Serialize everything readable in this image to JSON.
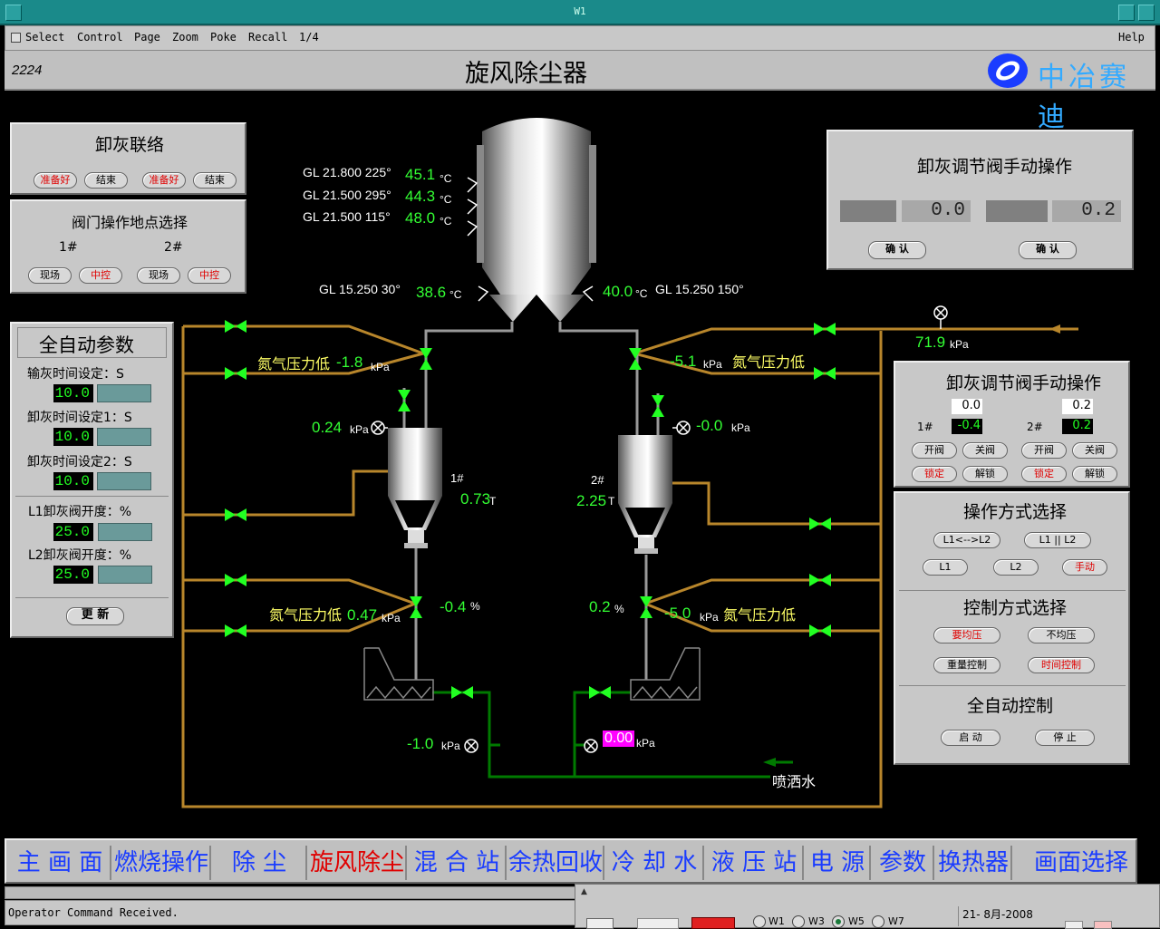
{
  "window": {
    "title": "W1"
  },
  "menu": {
    "select": "Select",
    "control": "Control",
    "page": "Page",
    "zoom": "Zoom",
    "poke": "Poke",
    "recall": "Recall",
    "page_count": "1/4",
    "help": "Help"
  },
  "header": {
    "page_id": "2224",
    "title": "旋风除尘器",
    "logo_text": "中冶赛迪"
  },
  "unload_link": {
    "title": "卸灰联络",
    "btn1": "准备好",
    "btn2": "结束",
    "btn3": "准备好",
    "btn4": "结束"
  },
  "valve_location": {
    "title": "阀门操作地点选择",
    "label1": "1#",
    "label2": "2#",
    "b1": "现场",
    "b2": "中控",
    "b3": "现场",
    "b4": "中控"
  },
  "auto_params": {
    "title": "全自动参数",
    "l1": "输灰时间设定：S",
    "v1": "10.0",
    "l2": "卸灰时间设定1：S",
    "v2": "10.0",
    "l3": "卸灰时间设定2：S",
    "v3": "10.0",
    "l4": "L1卸灰阀开度：%",
    "v4": "25.0",
    "l5": "L2卸灰阀开度：%",
    "v5": "25.0",
    "update": "更 新"
  },
  "manual_top": {
    "title": "卸灰调节阀手动操作",
    "v1": "0.0",
    "v2": "0.2",
    "confirm1": "确 认",
    "confirm2": "确 认"
  },
  "manual_right": {
    "title": "卸灰调节阀手动操作",
    "sp1": "0.0",
    "sp2": "0.2",
    "l1": "1#",
    "pv1": "-0.4",
    "l2": "2#",
    "pv2": "0.2",
    "open1": "开阀",
    "close1": "关阀",
    "open2": "开阀",
    "close2": "关阀",
    "lock1": "锁定",
    "unlock1": "解锁",
    "lock2": "锁定",
    "unlock2": "解锁"
  },
  "op_mode": {
    "title": "操作方式选择",
    "b1": "L1<-->L2",
    "b2": "L1 || L2",
    "b3": "L1",
    "b4": "L2",
    "b5": "手动"
  },
  "ctrl_mode": {
    "title": "控制方式选择",
    "b1": "要均压",
    "b2": "不均压",
    "b3": "重量控制",
    "b4": "时间控制"
  },
  "auto_ctrl": {
    "title": "全自动控制",
    "start": "启 动",
    "stop": "停 止"
  },
  "process": {
    "gl1": "GL 21.800 225°",
    "t1": "45.1",
    "gl2": "GL 21.500 295°",
    "t2": "44.3",
    "gl3": "GL 21.500 115°",
    "t3": "48.0",
    "gl4": "GL 15.250 30°",
    "t4": "38.6",
    "gl5": "GL 15.250 150°",
    "t5": "40.0",
    "unit_c": "°C",
    "unit_kpa": "kPa",
    "unit_t": "T",
    "unit_pct": "%",
    "n2_low": "氮气压力低",
    "p_left_top": "-1.8",
    "p_right_top": "-5.1",
    "p_inlet": "71.9",
    "p_tank1": "0.24",
    "p_tank2": "-0.0",
    "w1_label": "1#",
    "w1": "0.73",
    "w2_label": "2#",
    "w2": "2.25",
    "p_left_bot": "0.47",
    "v_left_bot": "-0.4",
    "p_right_bot": "-5.0",
    "v_right_bot": "0.2",
    "p_water1": "-1.0",
    "p_water2": "0.00",
    "spray": "喷洒水"
  },
  "nav": {
    "n1": "主 画 面",
    "n2": "燃烧操作",
    "n3": "除 尘",
    "n4": "旋风除尘",
    "n5": "混 合 站",
    "n6": "余热回收",
    "n7": "冷 却 水",
    "n8": "液 压 站",
    "n9": "电 源",
    "n10": "参数",
    "n11": "换热器",
    "n12": "画面选择"
  },
  "status": {
    "message": "Operator Command Received.",
    "date": "21- 8月-2008",
    "w1": "W1",
    "w3": "W3",
    "w5": "W5",
    "w7": "W7"
  }
}
